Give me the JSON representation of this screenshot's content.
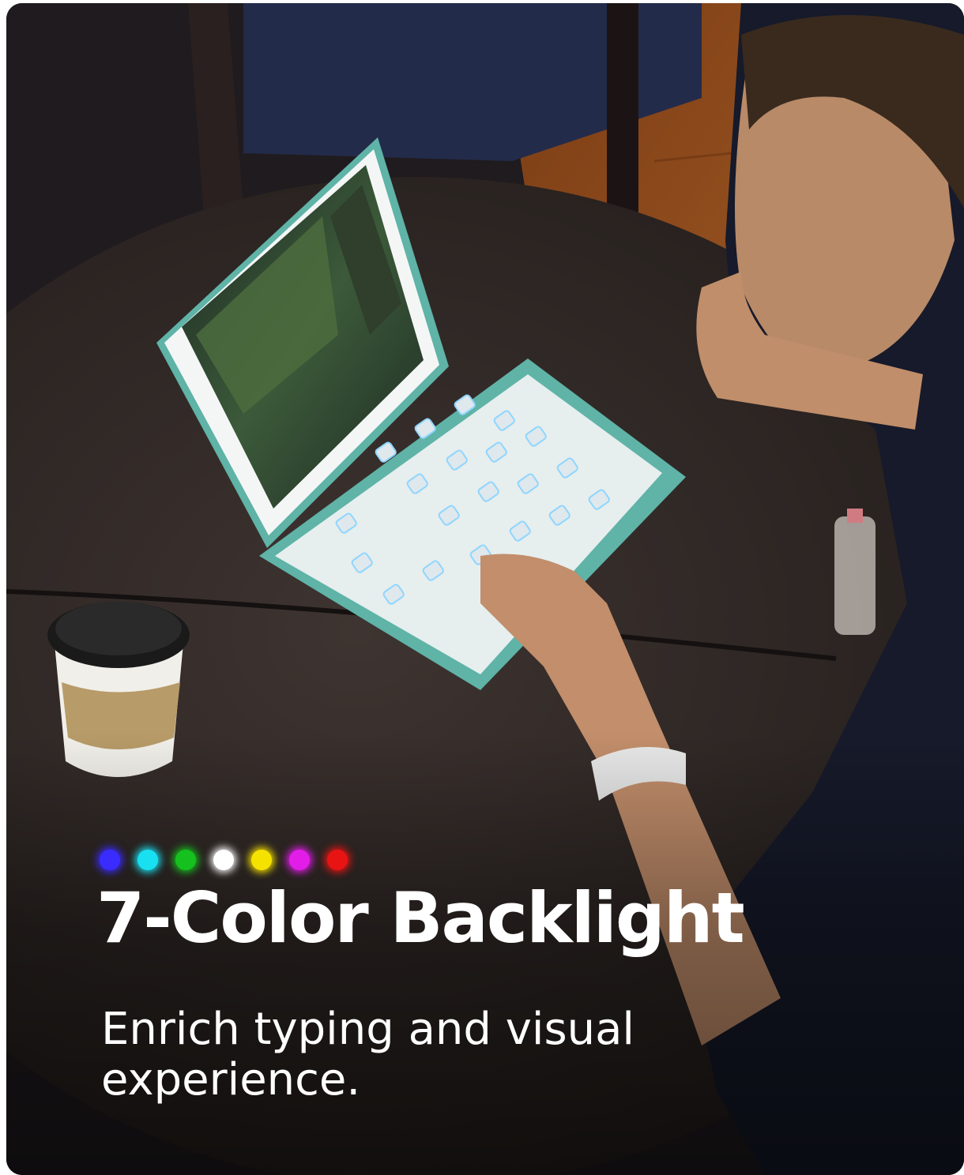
{
  "hero": {
    "headline": "7-Color Backlight",
    "subheadline": "Enrich typing and visual experience."
  },
  "color_dots": [
    "#3a2cff",
    "#19e0f0",
    "#16c01e",
    "#ffffff",
    "#f6e200",
    "#e21de8",
    "#e81414"
  ],
  "scene": {
    "accent_teal": "#5fb3a7",
    "key_glow": "#8fd6ff",
    "table_color": "#2f2724",
    "floor_color": "#a65c22"
  }
}
